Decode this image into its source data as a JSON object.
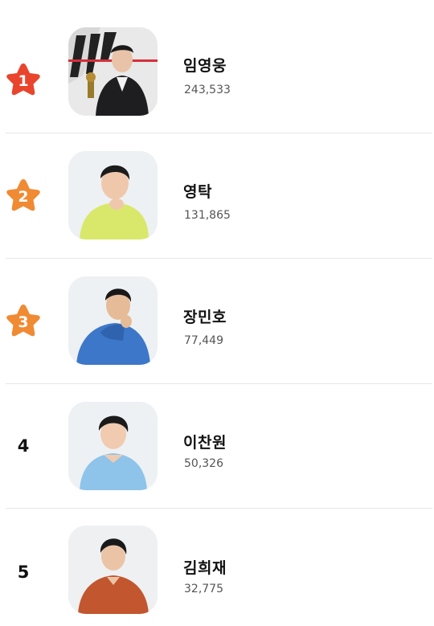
{
  "ranking": {
    "items": [
      {
        "rank": "1",
        "name": "임영웅",
        "count": "243,533",
        "star_color": "#e8452c",
        "icon": "star-badge-icon"
      },
      {
        "rank": "2",
        "name": "영탁",
        "count": "131,865",
        "star_color": "#f08a33",
        "icon": "star-badge-icon"
      },
      {
        "rank": "3",
        "name": "장민호",
        "count": "77,449",
        "star_color": "#f08a33",
        "icon": "star-badge-icon"
      },
      {
        "rank": "4",
        "name": "이찬원",
        "count": "50,326"
      },
      {
        "rank": "5",
        "name": "김희재",
        "count": "32,775"
      }
    ]
  }
}
